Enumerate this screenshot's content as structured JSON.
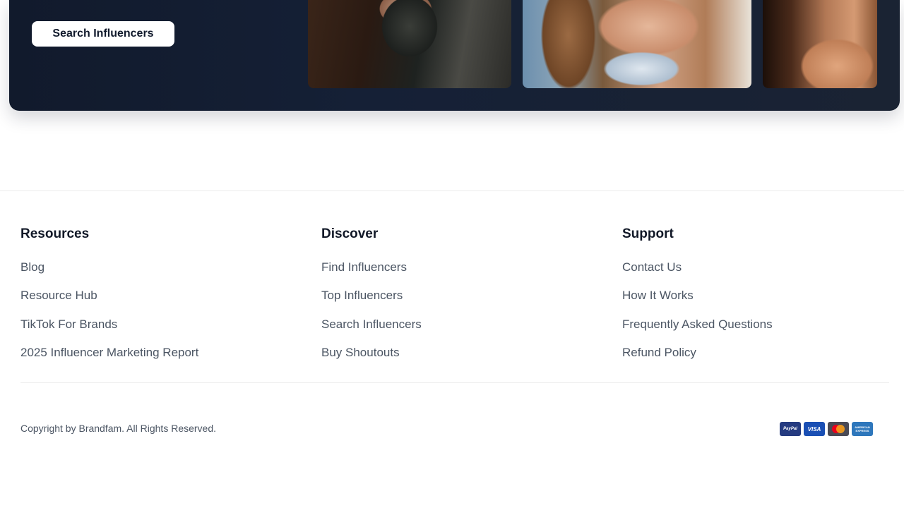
{
  "hero": {
    "button_label": "Search Influencers",
    "background_color": "#111a2c"
  },
  "footer": {
    "columns": [
      {
        "heading": "Resources",
        "links": [
          "Blog",
          "Resource Hub",
          "TikTok For Brands",
          "2025 Influencer Marketing Report"
        ]
      },
      {
        "heading": "Discover",
        "links": [
          "Find Influencers",
          "Top Influencers",
          "Search Influencers",
          "Buy Shoutouts"
        ]
      },
      {
        "heading": "Support",
        "links": [
          "Contact Us",
          "How It Works",
          "Frequently Asked Questions",
          "Refund Policy"
        ]
      }
    ],
    "copyright": "Copyright by Brandfam. All Rights Reserved.",
    "payment_icons": [
      {
        "name": "paypal-icon",
        "label": "PayPal"
      },
      {
        "name": "visa-icon",
        "label": "VISA"
      },
      {
        "name": "mastercard-icon",
        "label": ""
      },
      {
        "name": "amex-icon",
        "label": "AMERICAN EXPRESS"
      }
    ]
  }
}
